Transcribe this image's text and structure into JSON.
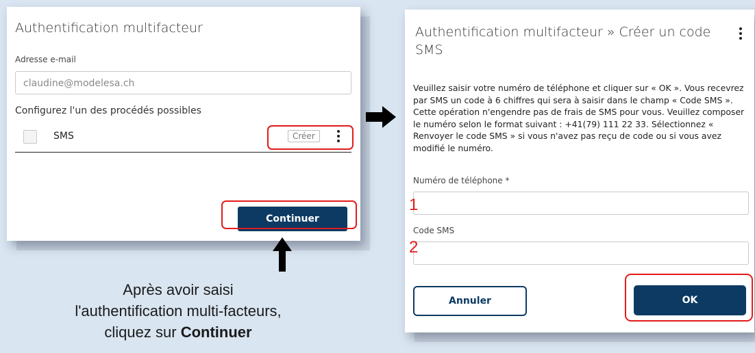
{
  "left_dialog": {
    "title": "Authentification multifacteur",
    "email_label": "Adresse e-mail",
    "email_value": "claudine@modelesa.ch",
    "methods_heading": "Configurez l'un des procédés possibles",
    "method_name": "SMS",
    "create_button": "Créer",
    "continue_button": "Continuer"
  },
  "right_dialog": {
    "title_line1": "Authentification multifacteur » Créer un code",
    "title_line2": "SMS",
    "instructions": "Veuillez saisir votre numéro de téléphone et cliquer sur « OK ». Vous recevrez par SMS un code à 6 chiffres qui sera à saisir dans le champ « Code SMS ». Cette opération n'engendre pas de frais de SMS pour vous. Veuillez composer le numéro selon le format suivant : +41(79) 111 22 33. Sélectionnez « Renvoyer le code SMS » si vous n'avez pas reçu de code ou si vous avez modifié le numéro.",
    "phone_label": "Numéro de téléphone *",
    "sms_code_label": "Code SMS",
    "cancel_button": "Annuler",
    "ok_button": "OK"
  },
  "annotations": {
    "marker_1": "1",
    "marker_2": "2",
    "caption_line1": "Après avoir saisi",
    "caption_line2": "l'authentification multi-facteurs,",
    "caption_line3_prefix": "cliquez sur",
    "caption_line3_bold": "Continuer"
  },
  "colors": {
    "primary_button": "#0d3a63",
    "highlight_red": "#e21a1a",
    "background": "#d9e5f1"
  }
}
